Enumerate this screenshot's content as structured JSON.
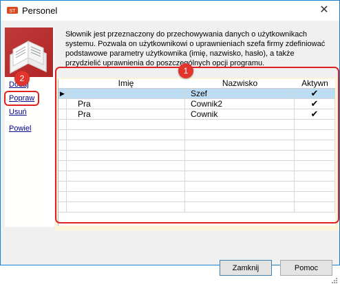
{
  "window": {
    "title": "Personel",
    "close_glyph": "✕"
  },
  "nav": {
    "add": "Dodaj",
    "edit": "Popraw",
    "delete": "Usuń",
    "duplicate": "Powiel"
  },
  "description": "Słownik jest przeznaczony do przechowywania danych o użytkownikach systemu. Pozwala on użytkownikowi o uprawnieniach szefa firmy zdefiniować podstawowe parametry użytkownika (imię, nazwisko, hasło), a także przydzielić uprawnienia do poszczególnych opcji programu.",
  "grid": {
    "columns": [
      "Imię",
      "Nazwisko",
      "Aktywn"
    ],
    "current_row_marker": "▶",
    "checkmark": "✔",
    "rows": [
      {
        "first": "",
        "last": "Szef",
        "active": true
      },
      {
        "first": "Pra",
        "last": "Cownik2",
        "active": true
      },
      {
        "first": "Pra",
        "last": "Cownik",
        "active": true
      }
    ],
    "empty_rows": 9
  },
  "annotations": {
    "badge1": "1",
    "badge2": "2"
  },
  "buttons": {
    "close": "Zamknij",
    "help": "Pomoc"
  },
  "colors": {
    "annotation_red": "#e02020",
    "selection": "#bcdcf3",
    "link": "#00008b",
    "frame_yellow": "#fbf4d6"
  },
  "icons": {
    "app": "app-logo-icon",
    "module": "books-icon"
  }
}
